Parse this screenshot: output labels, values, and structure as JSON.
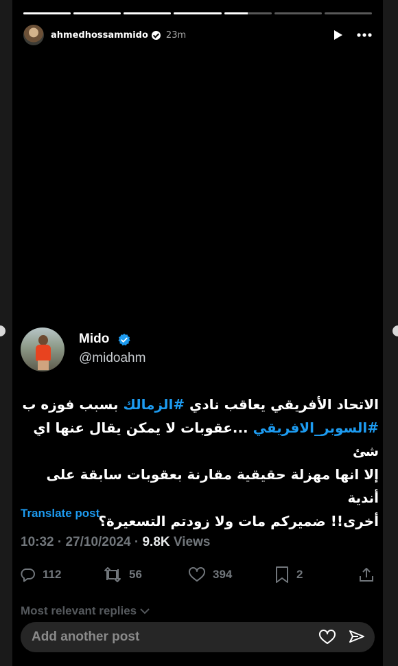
{
  "story": {
    "progress": [
      1,
      1,
      1,
      1,
      0.5,
      0,
      0
    ],
    "username": "ahmedhossammido",
    "time_ago": "23m"
  },
  "tweet": {
    "display_name": "Mido",
    "handle": "@midoahm",
    "text_line1_a": "الاتحاد الأفريقي يعاقب نادي ",
    "hashtag_zamalek": "#الزمالك",
    "text_line1_b": " بسبب فوزه ب",
    "hashtag_super": "#السوبر_الافريقي",
    "text_line2": " ...عقوبات لا يمكن يقال عنها اي شئ",
    "text_line3": "إلا انها مهزلة حقيقية مقارنة بعقوبات سابقة على أندية",
    "text_line4": "أخرى!! ضميركم مات ولا زودتم التسعيرة؟",
    "translate_label": "Translate post",
    "timestamp": "10:32 · 27/10/2024 · ",
    "views_count": "9.8K",
    "views_label": " Views",
    "replies": "112",
    "reposts": "56",
    "likes": "394",
    "bookmarks": "2",
    "replies_sort": "Most relevant replies"
  },
  "composer": {
    "placeholder": "Add another post"
  },
  "colors": {
    "accent": "#1d9bf0",
    "muted": "#71767b"
  },
  "icons": [
    "verified-icon",
    "play-icon",
    "more-icon",
    "reply-icon",
    "repost-icon",
    "like-icon",
    "bookmark-icon",
    "share-icon",
    "chevron-down-icon",
    "heart-icon",
    "send-icon"
  ]
}
